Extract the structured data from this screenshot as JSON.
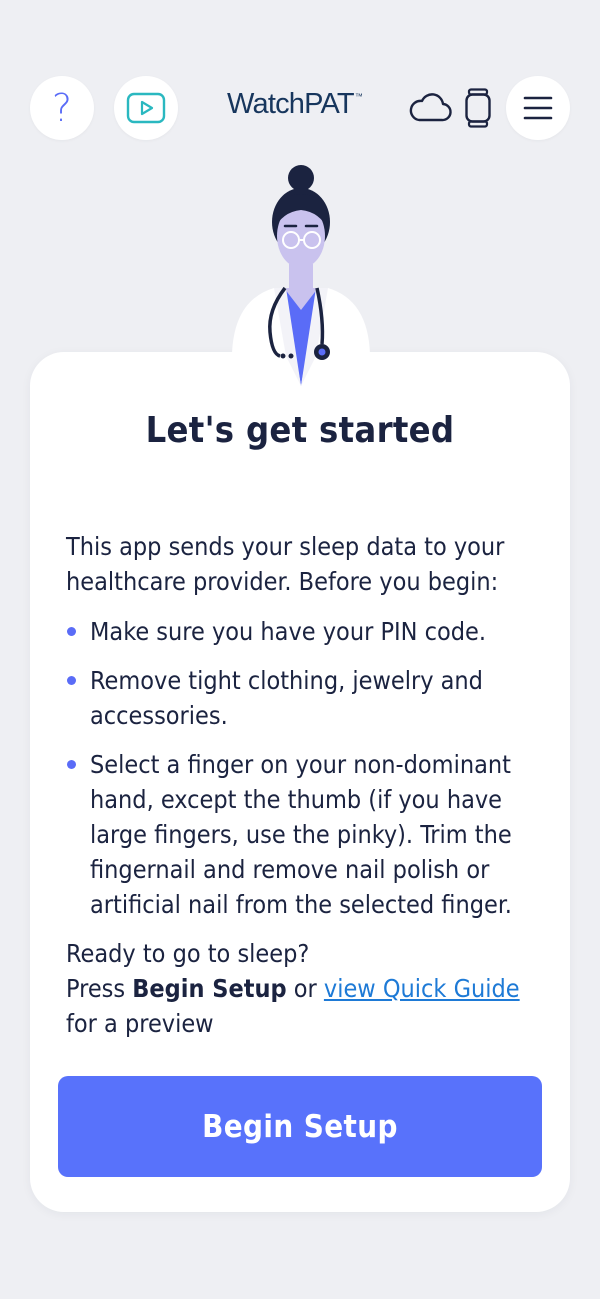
{
  "header": {
    "help_icon": "question-mark-icon",
    "help_glyph": "?",
    "video_icon": "play-video-icon",
    "logo_watch": "Watch",
    "logo_pat": "PAT",
    "logo_tm": "™",
    "cloud_icon": "cloud-icon",
    "device_icon": "watch-device-icon",
    "menu_icon": "hamburger-menu-icon"
  },
  "illustration": "doctor-illustration",
  "card": {
    "title": "Let's get started",
    "intro": "This app sends your sleep data to your healthcare provider. Before you begin:",
    "bullets": [
      "Make sure you have your PIN code.",
      "Remove tight clothing, jewelry and accessories.",
      "Select a finger on your non-dominant hand, except the thumb (if you have large fingers, use the pinky). Trim the fingernail and remove nail polish or artificial nail from the selected finger."
    ],
    "ready_line": "Ready to go to sleep?",
    "press": "Press ",
    "begin_setup_bold": "Begin Setup",
    "or": " or ",
    "quick_guide_link": "view Quick Guide",
    "preview_suffix": " for a preview",
    "begin_button": "Begin Setup"
  },
  "colors": {
    "background": "#eeeff3",
    "accent": "#5a6cf7",
    "button": "#5872fb",
    "text": "#1b2340",
    "link": "#1e7ad6",
    "logo": "#17365d"
  }
}
